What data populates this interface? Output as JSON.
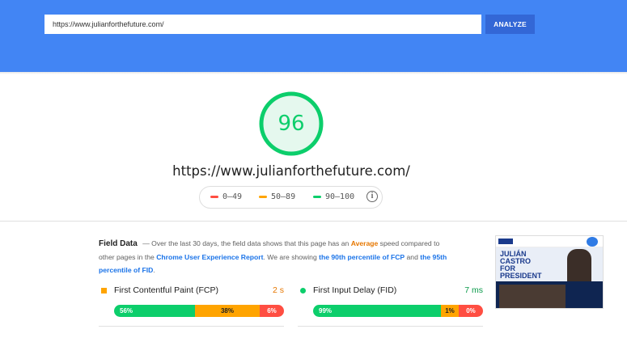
{
  "search": {
    "url_value": "https://www.julianforthefuture.com/",
    "analyze_label": "ANALYZE"
  },
  "report": {
    "score": "96",
    "tested_url": "https://www.julianforthefuture.com/"
  },
  "legend": {
    "poor": "0–49",
    "average": "50–89",
    "good": "90–100",
    "info_icon": "info-icon"
  },
  "field_data": {
    "title": "Field Data",
    "desc_pre": "— Over the last 30 days, the field data shows that this page has an ",
    "rating": "Average",
    "desc_mid": " speed compared to other pages in the ",
    "crux_link": "Chrome User Experience Report",
    "desc_mid2": ". We are showing ",
    "fcp_link": "the 90th percentile of FCP",
    "desc_and": " and ",
    "fid_link": "the 95th percentile of FID",
    "desc_end": "."
  },
  "metrics": [
    {
      "name": "First Contentful Paint (FCP)",
      "value": "2 s",
      "value_color": "#e67700",
      "fast": "56%",
      "average": "38%",
      "slow": "6%",
      "fast_pct": 56,
      "avg_pct": 38,
      "slow_pct": 6
    },
    {
      "name": "First Input Delay (FID)",
      "value": "7 ms",
      "value_color": "#0a9a4a",
      "fast": "99%",
      "average": "1%",
      "slow": "0%",
      "fast_pct": 99,
      "avg_pct": 1,
      "slow_pct": 0
    }
  ],
  "thumbnail": {
    "headline_line1": "JULIÁN CASTRO",
    "headline_line2": "FOR PRESIDENT"
  },
  "colors": {
    "brand_blue": "#4285f4",
    "button_blue": "#3367d6",
    "good": "#0cce6b",
    "average": "#ffa400",
    "poor": "#ff4e42"
  }
}
